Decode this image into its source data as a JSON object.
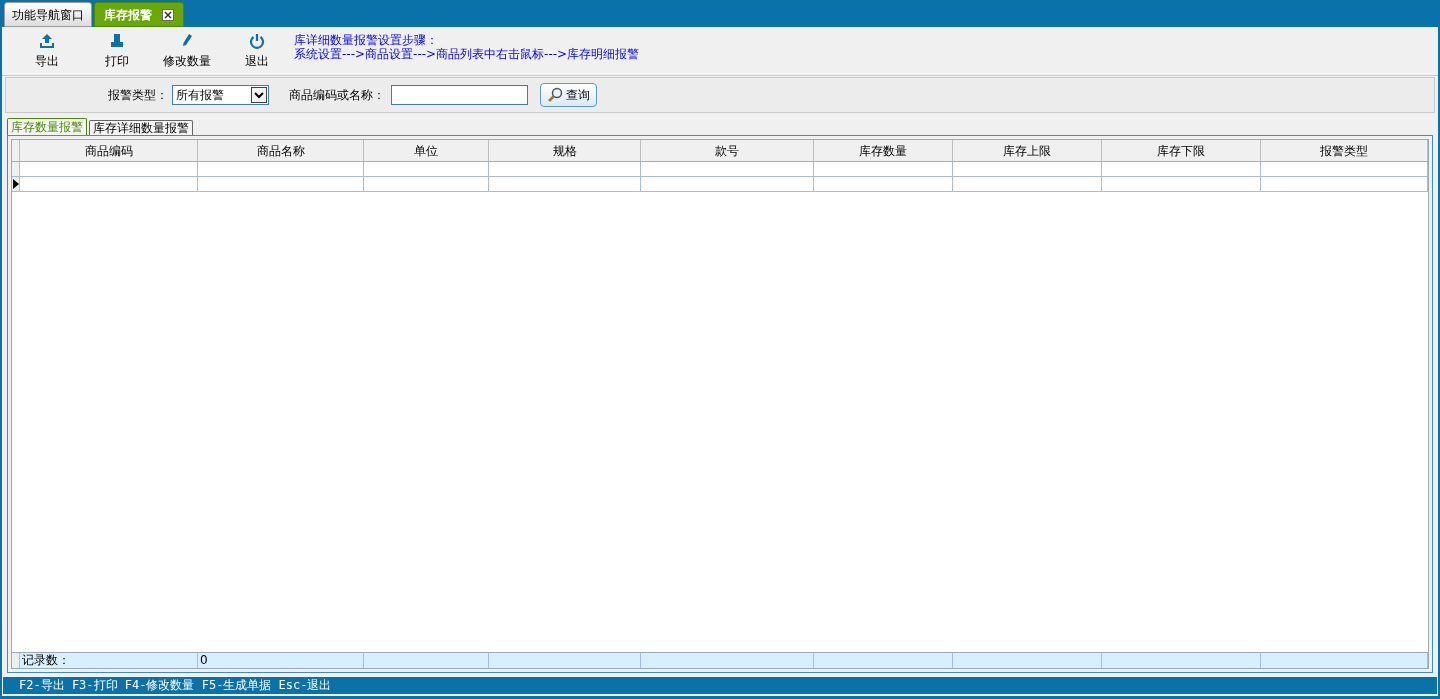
{
  "window_tabs": [
    {
      "label": "功能导航窗口",
      "selected": false,
      "closable": false
    },
    {
      "label": "库存报警",
      "selected": true,
      "closable": true
    }
  ],
  "toolbar": [
    {
      "kind": "export",
      "label": "导出"
    },
    {
      "kind": "print",
      "label": "打印"
    },
    {
      "kind": "edit",
      "label": "修改数量"
    },
    {
      "kind": "exit",
      "label": "退出"
    }
  ],
  "hint": [
    "库详细数量报警设置步骤：",
    "系统设置--->商品设置--->商品列表中右击鼠标--->库存明细报警"
  ],
  "filter": {
    "type_label": "报警类型：",
    "type_value": "所有报警",
    "search_label": "商品编码或名称：",
    "search_button": "查询"
  },
  "sub_tabs": [
    {
      "label": "库存数量报警",
      "selected": true
    },
    {
      "label": "库存详细数量报警",
      "selected": false
    }
  ],
  "table": {
    "columns": [
      "商品编码",
      "商品名称",
      "单位",
      "规格",
      "款号",
      "库存数量",
      "库存上限",
      "库存下限",
      "报警类型"
    ],
    "rows": [
      {
        "selected": false
      },
      {
        "selected": true
      }
    ],
    "footer": [
      "记录数：",
      "0"
    ]
  },
  "status_bar": "F2-导出 F3-打印 F4-修改数量 F5-生成单据 Esc-退出"
}
